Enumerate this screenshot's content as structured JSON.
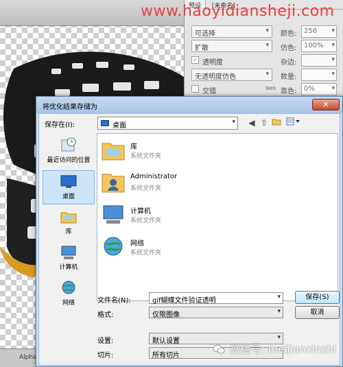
{
  "watermark": "www.haoyidiansheji.com",
  "panel": {
    "tabs": [
      "预设",
      "[未命名]"
    ],
    "rows": [
      {
        "select": "可选择",
        "label": "颜色:",
        "value": "256"
      },
      {
        "select": "扩散",
        "label": "仿色:",
        "value": "100%"
      },
      {
        "check_mark": "✓",
        "check_label": "透明度",
        "label": "杂边:",
        "value": ""
      },
      {
        "select": "无透明度仿色",
        "label": "数量:",
        "value": ""
      },
      {
        "check_label": "交错",
        "web_label": "Web",
        "label": "靠色:",
        "value": "0%"
      }
    ]
  },
  "status_bar": {
    "text": "Alpha"
  },
  "dialog": {
    "title": "将优化结果存储为",
    "close_glyph": "✕",
    "save_in_label": "保存在(I):",
    "save_in_value": "桌面",
    "places": [
      {
        "label": "最近访问的位置",
        "selected": false
      },
      {
        "label": "桌面",
        "selected": true
      },
      {
        "label": "库",
        "selected": false
      },
      {
        "label": "计算机",
        "selected": false
      },
      {
        "label": "网络",
        "selected": false
      }
    ],
    "files": [
      {
        "name": "库",
        "type": "系统文件夹"
      },
      {
        "name": "Administrator",
        "type": "系统文件夹"
      },
      {
        "name": "计算机",
        "type": "系统文件夹"
      },
      {
        "name": "网络",
        "type": "系统文件夹"
      }
    ],
    "filename_label": "文件名(N):",
    "filename_value": "gif蝴蝶文件验证透明",
    "format_label": "格式:",
    "format_value": "仅限图像",
    "settings_label": "设置:",
    "settings_value": "默认设置",
    "slices_label": "切片:",
    "slices_value": "所有切片",
    "save_button": "保存(S)",
    "cancel_button": "取消"
  },
  "wechat_watermark": "微信号: meijianxinzhi"
}
